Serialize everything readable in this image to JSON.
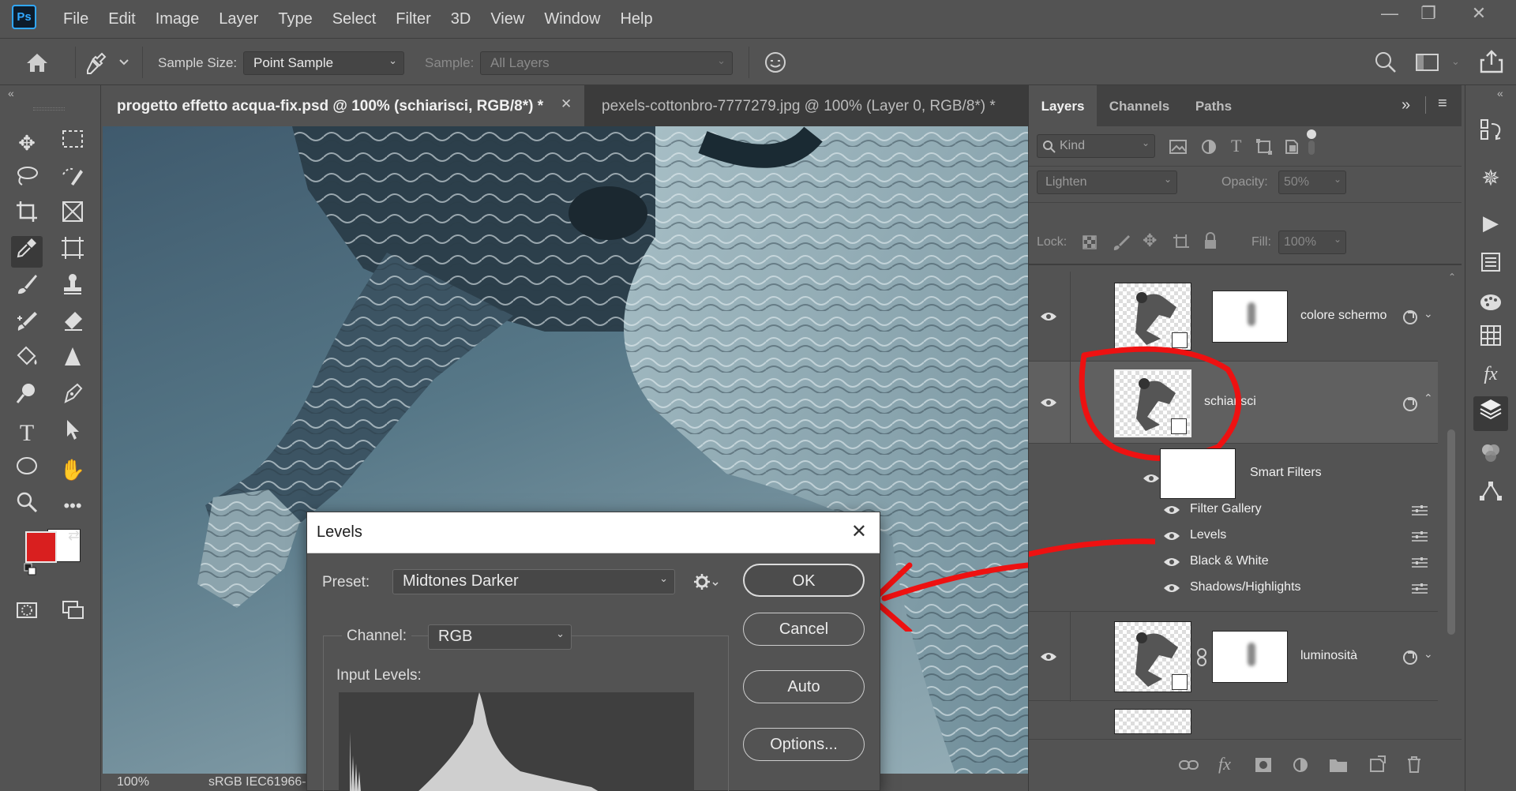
{
  "app": {
    "logo": "Ps",
    "accent_color": "#31a8ff"
  },
  "menu": [
    "File",
    "Edit",
    "Image",
    "Layer",
    "Type",
    "Select",
    "Filter",
    "3D",
    "View",
    "Window",
    "Help"
  ],
  "window_controls": {
    "minimize": "—",
    "restore": "❐",
    "close": "✕"
  },
  "options_bar": {
    "sample_size_label": "Sample Size:",
    "sample_size_value": "Point Sample",
    "sample_label": "Sample:",
    "sample_value": "All Layers"
  },
  "panel_collapse": {
    "left": "«",
    "right": "«"
  },
  "tabs": [
    {
      "label": "progetto effetto acqua-fix.psd @ 100% (schiarisci, RGB/8*) *",
      "close": "✕"
    },
    {
      "label": "pexels-cottonbro-7777279.jpg @ 100% (Layer 0, RGB/8*) *"
    }
  ],
  "status": {
    "zoom": "100%",
    "profile": "sRGB IEC61966-"
  },
  "colors": {
    "foreground": "#d91f1f",
    "background": "#ffffff",
    "annotation": "#ee1111"
  },
  "levels": {
    "title": "Levels",
    "preset_label": "Preset:",
    "preset_value": "Midtones Darker",
    "channel_label": "Channel:",
    "channel_value": "RGB",
    "input_levels_label": "Input Levels:",
    "buttons": {
      "ok": "OK",
      "cancel": "Cancel",
      "auto": "Auto",
      "options": "Options..."
    }
  },
  "layers_panel": {
    "tabs": [
      "Layers",
      "Channels",
      "Paths"
    ],
    "filter_kind": "Kind",
    "blend_mode": "Lighten",
    "opacity_label": "Opacity:",
    "opacity_value": "50%",
    "lock_label": "Lock:",
    "fill_label": "Fill:",
    "fill_value": "100%",
    "layers": [
      {
        "name": "colore schermo"
      },
      {
        "name": "schiarisci",
        "selected": true
      },
      {
        "name": "luminosità"
      }
    ],
    "smart_filters_label": "Smart Filters",
    "smart_filters": [
      "Filter Gallery",
      "Levels",
      "Black & White",
      "Shadows/Highlights"
    ]
  },
  "icons": [
    "home-icon",
    "eyedropper-icon",
    "target-icon",
    "search-icon",
    "workspace-icon",
    "share-icon",
    "move-icon",
    "marquee-icon",
    "lasso-icon",
    "quick-select-icon",
    "crop-icon",
    "frame-icon",
    "eyedropper-tool-icon",
    "artboard-icon",
    "brush-icon",
    "stamp-icon",
    "healing-icon",
    "eraser-icon",
    "paint-bucket-icon",
    "sharpen-icon",
    "dodge-icon",
    "pen-icon",
    "type-icon",
    "path-select-icon",
    "ellipse-icon",
    "hand-icon",
    "zoom-icon",
    "more-icon",
    "eye-icon",
    "gear-icon",
    "link-icon",
    "fx-icon",
    "mask-icon",
    "adjustment-icon",
    "folder-icon",
    "new-layer-icon",
    "trash-icon"
  ]
}
